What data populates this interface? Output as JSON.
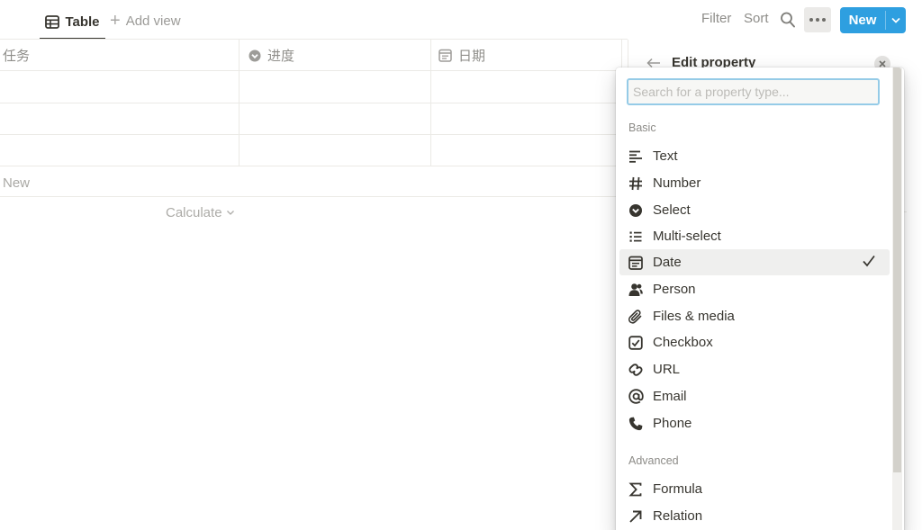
{
  "toolbar": {
    "view_tab_label": "Table",
    "add_view_label": "Add view",
    "filter_label": "Filter",
    "sort_label": "Sort",
    "new_label": "New"
  },
  "table": {
    "columns": [
      {
        "label": "任务",
        "icon": "none"
      },
      {
        "label": "进度",
        "icon": "select-icon"
      },
      {
        "label": "日期",
        "icon": "calendar-icon"
      }
    ],
    "new_row_label": "New",
    "calculate_label": "Calculate"
  },
  "edit_panel": {
    "title": "Edit property"
  },
  "menu": {
    "search_placeholder": "Search for a property type...",
    "sections": [
      {
        "label": "Basic",
        "items": [
          {
            "label": "Text",
            "icon": "text-icon"
          },
          {
            "label": "Number",
            "icon": "number-icon"
          },
          {
            "label": "Select",
            "icon": "select-icon"
          },
          {
            "label": "Multi-select",
            "icon": "multi-select-icon"
          },
          {
            "label": "Date",
            "icon": "calendar-icon",
            "selected": true
          },
          {
            "label": "Person",
            "icon": "person-icon"
          },
          {
            "label": "Files & media",
            "icon": "paperclip-icon"
          },
          {
            "label": "Checkbox",
            "icon": "checkbox-icon"
          },
          {
            "label": "URL",
            "icon": "link-icon"
          },
          {
            "label": "Email",
            "icon": "at-icon"
          },
          {
            "label": "Phone",
            "icon": "phone-icon"
          }
        ]
      },
      {
        "label": "Advanced",
        "items": [
          {
            "label": "Formula",
            "icon": "sigma-icon"
          },
          {
            "label": "Relation",
            "icon": "arrow-up-right-icon"
          }
        ]
      }
    ]
  },
  "colors": {
    "accent": "#2e9fe0",
    "text": "#37352f",
    "muted": "#8f8e8a",
    "selected_bg": "#efefee",
    "border": "#ebeae6"
  }
}
